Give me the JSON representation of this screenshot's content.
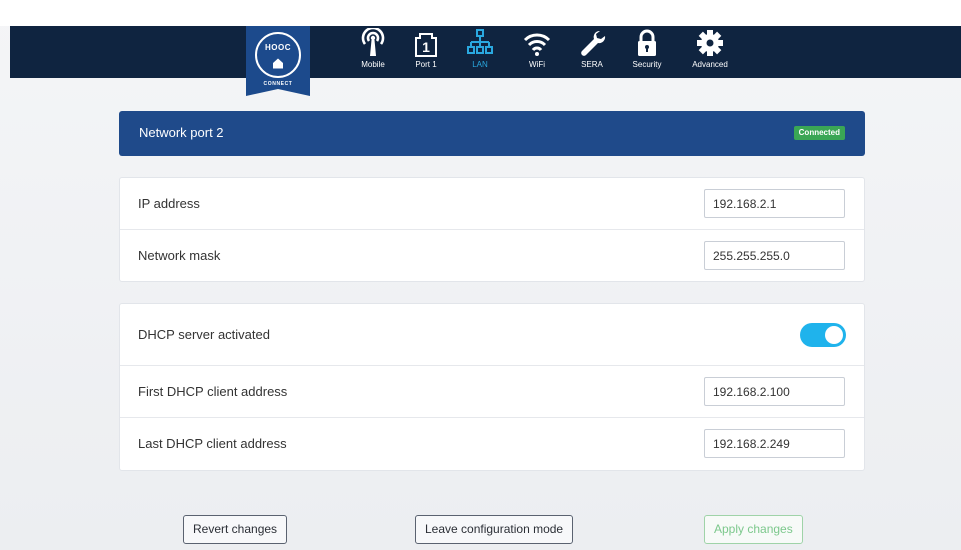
{
  "logo": {
    "text": "HOOC",
    "subtitle": "CONNECT"
  },
  "nav": [
    {
      "label": "Mobile",
      "icon": "antenna-icon",
      "active": false
    },
    {
      "label": "Port 1",
      "icon": "port-1-icon",
      "active": false
    },
    {
      "label": "LAN",
      "icon": "lan-network-icon",
      "active": true
    },
    {
      "label": "WiFi",
      "icon": "wifi-icon",
      "active": false
    },
    {
      "label": "SERA",
      "icon": "wrench-icon",
      "active": false
    },
    {
      "label": "Security",
      "icon": "lock-icon",
      "active": false
    },
    {
      "label": "Advanced",
      "icon": "gear-icon",
      "active": false
    }
  ],
  "header": {
    "title": "Network port 2",
    "status": "Connected",
    "status_color": "#3aa655"
  },
  "network": {
    "ip_label": "IP address",
    "ip_value": "192.168.2.1",
    "mask_label": "Network mask",
    "mask_value": "255.255.255.0"
  },
  "dhcp": {
    "server_label": "DHCP server activated",
    "server_enabled": true,
    "first_label": "First DHCP client address",
    "first_value": "192.168.2.100",
    "last_label": "Last DHCP client address",
    "last_value": "192.168.2.249"
  },
  "buttons": {
    "revert": "Revert changes",
    "leave": "Leave configuration mode",
    "apply": "Apply changes"
  },
  "colors": {
    "navbar": "#0f2440",
    "header": "#1f4a8a",
    "accent": "#2aa9e0",
    "toggle_on": "#1fb3ec"
  }
}
